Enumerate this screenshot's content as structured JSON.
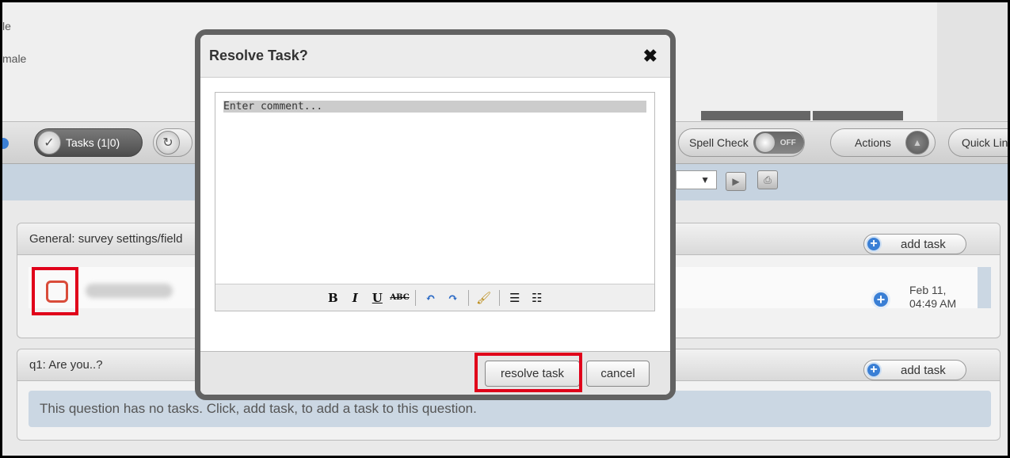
{
  "background": {
    "top_text_lines": [
      "le",
      "male"
    ]
  },
  "toolbar": {
    "tasks_label": "Tasks (1|0)",
    "spell_check_label": "Spell Check",
    "spell_check_state": "OFF",
    "actions_label": "Actions",
    "quick_links_label": "Quick Lin"
  },
  "panels": [
    {
      "header": "General: survey settings/field",
      "add_task_label": "add task",
      "task": {
        "date_line1": "Feb 11,",
        "date_line2": "04:49 AM"
      }
    },
    {
      "header": "q1: Are you..?",
      "add_task_label": "add task",
      "empty_message": "This question has no tasks. Click, add task, to add a task to this question."
    }
  ],
  "modal": {
    "title": "Resolve Task?",
    "comment_placeholder": "Enter comment...",
    "editor_tools": {
      "bold": "B",
      "italic": "I",
      "underline": "U",
      "strikethrough": "ABC"
    },
    "resolve_button": "resolve task",
    "cancel_button": "cancel"
  },
  "colors": {
    "highlight": "#e0001a",
    "accent_blue": "#3a7fd5",
    "checkbox_red": "#d94c3a"
  }
}
